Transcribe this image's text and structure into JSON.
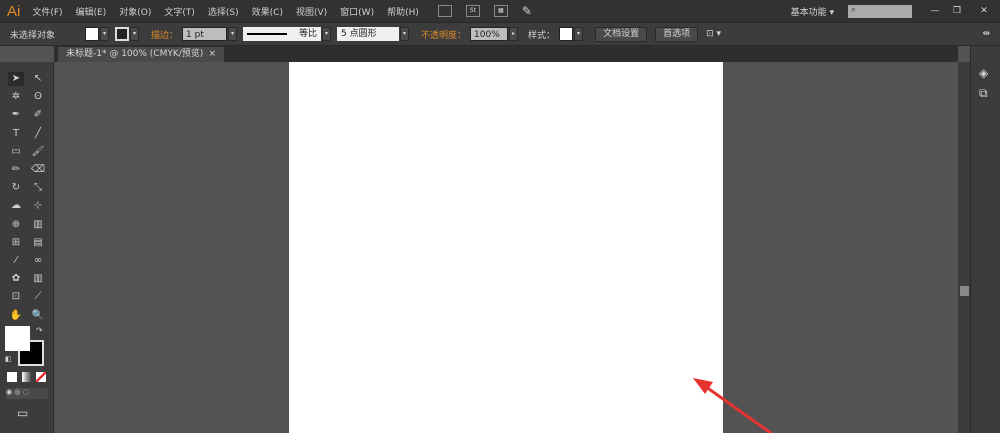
{
  "app": {
    "logo": "Ai",
    "workspace": "基本功能",
    "search_placeholder": ""
  },
  "menus": [
    "文件(F)",
    "编辑(E)",
    "对象(O)",
    "文字(T)",
    "选择(S)",
    "效果(C)",
    "视图(V)",
    "窗口(W)",
    "帮助(H)"
  ],
  "control": {
    "selection": "未选择对象",
    "stroke_label": "描边：",
    "stroke_value": "1 pt",
    "profile": "等比",
    "brush": "5 点圆形",
    "opacity_label": "不透明度：",
    "opacity_value": "100%",
    "style_label": "样式：",
    "doc_setup": "文档设置",
    "prefs": "首选项"
  },
  "document_tab": {
    "title": "未标题-1* @ 100% (CMYK/预览)",
    "close": "×"
  },
  "tools": [
    "selection",
    "direct-selection",
    "magic-wand",
    "lasso",
    "pen",
    "curvature",
    "type",
    "line",
    "rectangle",
    "paintbrush",
    "pencil",
    "eraser",
    "rotate",
    "scale",
    "warp",
    "free-transform",
    "shape-builder",
    "perspective",
    "mesh",
    "gradient",
    "eyedropper",
    "blend",
    "symbol-sprayer",
    "column-graph",
    "artboard",
    "slice",
    "hand",
    "zoom"
  ],
  "colors": {
    "accent": "#e08a2c",
    "annotation_arrow": "#e8322f",
    "fill": "#ffffff",
    "stroke": "#000000"
  }
}
